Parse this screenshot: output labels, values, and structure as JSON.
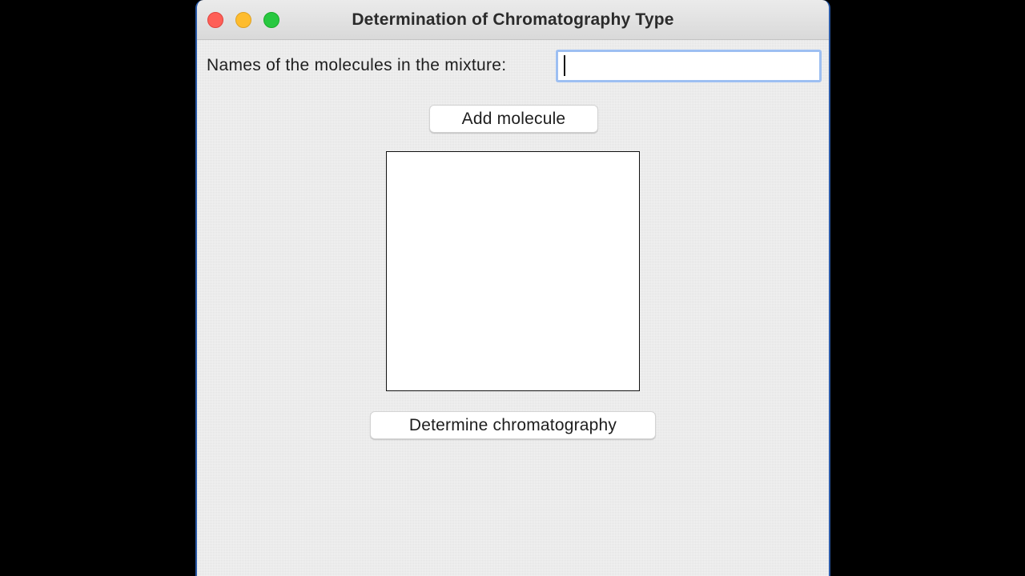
{
  "window": {
    "title": "Determination of Chromatography Type",
    "buttons": [
      "close",
      "minimize",
      "zoom"
    ]
  },
  "form": {
    "molecule_label": "Names of the molecules in the mixture:",
    "molecule_input_value": "",
    "add_button_label": "Add molecule",
    "molecule_list": [],
    "determine_button_label": "Determine chromatography"
  },
  "colors": {
    "close": "#fe5f57",
    "minimize": "#febc2e",
    "zoom": "#28c840",
    "focus_ring": "#9dbff2"
  }
}
